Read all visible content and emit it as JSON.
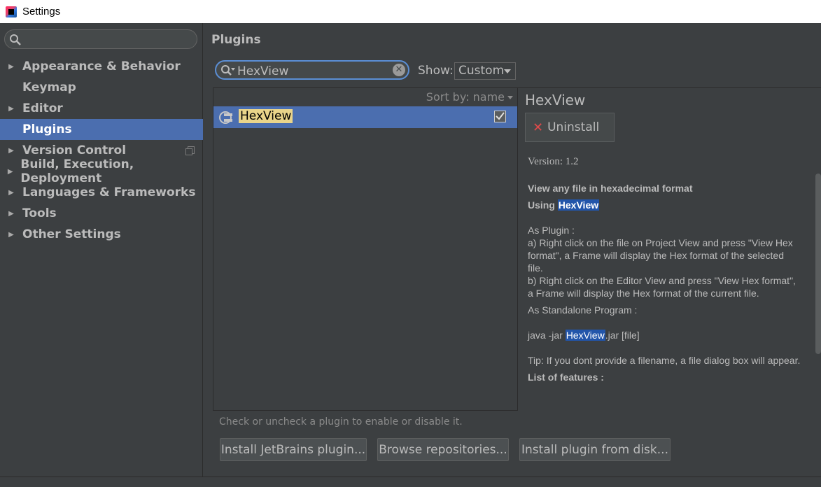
{
  "window": {
    "title": "Settings"
  },
  "sidebar": {
    "search_placeholder": "",
    "items": [
      {
        "label": "Appearance & Behavior",
        "expandable": true,
        "selected": false
      },
      {
        "label": "Keymap",
        "expandable": false,
        "selected": false
      },
      {
        "label": "Editor",
        "expandable": true,
        "selected": false
      },
      {
        "label": "Plugins",
        "expandable": false,
        "selected": true
      },
      {
        "label": "Version Control",
        "expandable": true,
        "selected": false
      },
      {
        "label": "Build, Execution, Deployment",
        "expandable": true,
        "selected": false
      },
      {
        "label": "Languages & Frameworks",
        "expandable": true,
        "selected": false
      },
      {
        "label": "Tools",
        "expandable": true,
        "selected": false
      },
      {
        "label": "Other Settings",
        "expandable": true,
        "selected": false
      }
    ]
  },
  "main": {
    "title": "Plugins",
    "search_value": "HexView",
    "show_label": "Show:",
    "show_value": "Custom",
    "sort_label": "Sort by: name",
    "plugins": [
      {
        "name": "HexView",
        "enabled": true
      }
    ],
    "hint": "Check or uncheck a plugin to enable or disable it.",
    "buttons": {
      "install_jetbrains": "Install JetBrains plugin...",
      "browse": "Browse repositories...",
      "install_disk": "Install plugin from disk..."
    }
  },
  "detail": {
    "name": "HexView",
    "uninstall_label": "Uninstall",
    "version": "Version: 1.2",
    "heading1": "View any file in hexadecimal format",
    "heading2_prefix": "Using ",
    "heading2_highlight": "HexView",
    "as_plugin": "As Plugin :",
    "line_a": "a) Right click on the file on Project View and press \"View Hex format\", a Frame will display the Hex format of the selected file.",
    "line_b": "b) Right click on the Editor View and press \"View Hex format\", a Frame will display the Hex format of the current file.",
    "standalone": "As Standalone Program :",
    "cmd_prefix": "java -jar ",
    "cmd_highlight": "HexView",
    "cmd_suffix": ".jar [file]",
    "tip": "Tip: If you dont provide a filename, a file dialog box will appear.",
    "features": "List of features :"
  },
  "colors": {
    "selection": "#4b6eaf",
    "background": "#3c3f41",
    "search_focus": "#5b8fd6",
    "highlight": "#2255aa"
  }
}
